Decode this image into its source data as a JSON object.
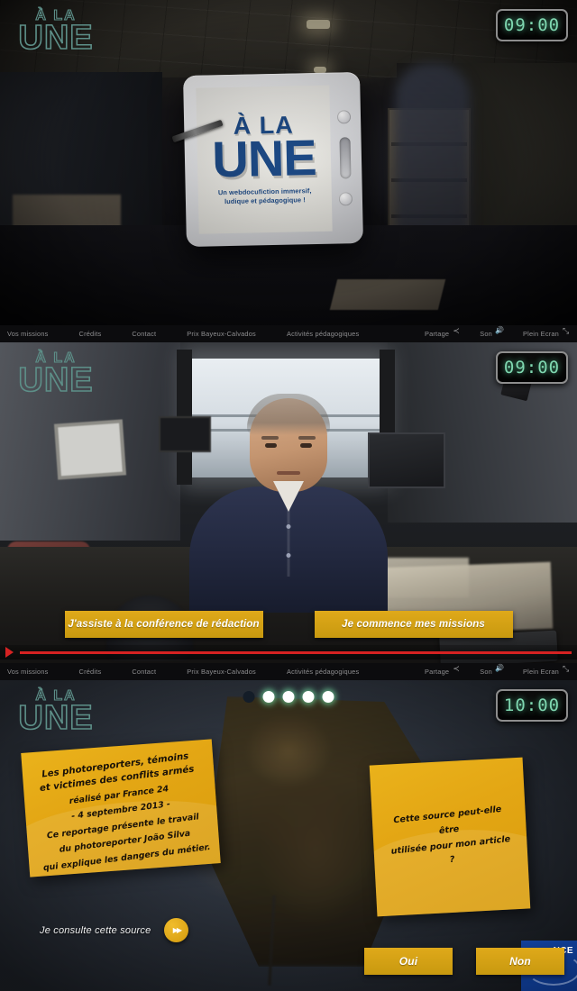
{
  "brand": {
    "logo_line1": "À LA",
    "logo_line2": "UNE",
    "logo_color": "#5d8f88",
    "accent_gold": "#dfa91a",
    "accent_red": "#d62222",
    "clock_green": "#7fd7b0"
  },
  "nav": {
    "items": [
      {
        "label": "Vos missions"
      },
      {
        "label": "Crédits"
      },
      {
        "label": "Contact"
      },
      {
        "label": "Prix Bayeux-Calvados"
      },
      {
        "label": "Activités pédagogiques"
      }
    ],
    "tools": [
      {
        "label": "Partage",
        "icon": "share-icon"
      },
      {
        "label": "Son",
        "icon": "sound-icon"
      },
      {
        "label": "Plein Ecran",
        "icon": "fullscreen-icon"
      }
    ]
  },
  "panel1": {
    "clock": "09:00",
    "tablet": {
      "title_line1": "À LA",
      "title_line2": "UNE",
      "subtitle_line1": "Un webdocufiction immersif,",
      "subtitle_line2": "ludique et pédagogique !"
    }
  },
  "panel2": {
    "clock": "09:00",
    "buttons": [
      {
        "label": "J'assiste à la conférence de rédaction"
      },
      {
        "label": "Je commence mes missions"
      }
    ],
    "scrubber": {
      "progress_percent": 100
    }
  },
  "panel3": {
    "clock": "10:00",
    "dots": [
      {
        "state": "off"
      },
      {
        "state": "on"
      },
      {
        "state": "on"
      },
      {
        "state": "on"
      },
      {
        "state": "on"
      }
    ],
    "source_note": {
      "title_line1": "Les photoreporters, témoins",
      "title_line2": "et victimes des conflits armés",
      "line3": "réalisé par France 24",
      "line4": "- 4 septembre 2013 -",
      "line5": "Ce reportage présente le travail",
      "line6": "du photoreporter João Silva",
      "line7": "qui explique les dangers du métier."
    },
    "question_note": {
      "line1": "Cette source peut-elle être",
      "line2": "utilisée pour mon article ?"
    },
    "consult_label": "Je consulte cette source",
    "answers": [
      {
        "label": "Oui"
      },
      {
        "label": "Non"
      }
    ],
    "watermark": "NCE"
  }
}
